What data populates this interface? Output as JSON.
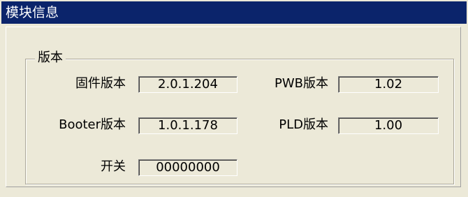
{
  "window": {
    "title": "模块信息"
  },
  "version_group": {
    "title": "版本",
    "firmware": {
      "label": "固件版本",
      "value": "2.0.1.204"
    },
    "pwb": {
      "label": "PWB版本",
      "value": "1.02"
    },
    "booter": {
      "label": "Booter版本",
      "value": "1.0.1.178"
    },
    "pld": {
      "label": "PLD版本",
      "value": "1.00"
    },
    "switch": {
      "label": "开关",
      "value": "00000000"
    }
  },
  "colors": {
    "titlebar": "#0b246b",
    "panel": "#ece9d8"
  }
}
